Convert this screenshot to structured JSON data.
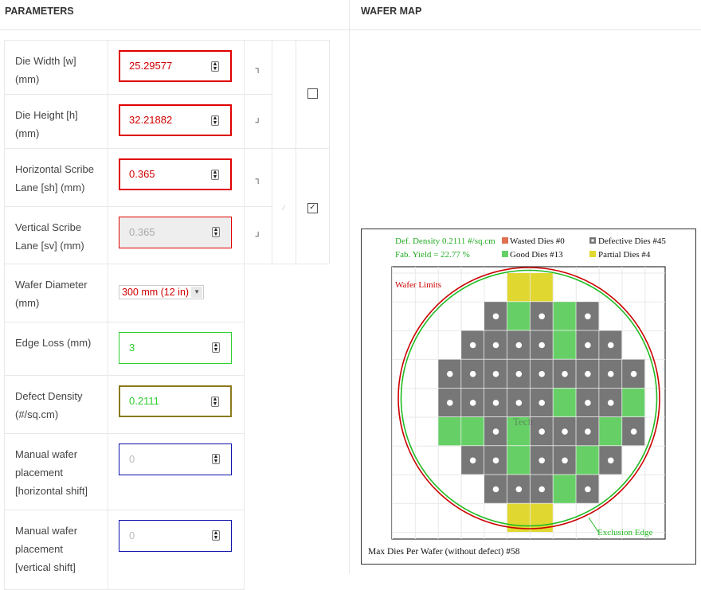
{
  "headers": {
    "parameters": "PARAMETERS",
    "wafer_map": "WAFER MAP"
  },
  "params": [
    {
      "id": "die_width",
      "label": "Die Width [w] (mm)",
      "value": "25.29577"
    },
    {
      "id": "die_height",
      "label": "Die Height [h] (mm)",
      "value": "32.21882"
    },
    {
      "id": "h_scribe",
      "label": "Horizontal Scribe Lane [sh] (mm)",
      "value": "0.365"
    },
    {
      "id": "v_scribe",
      "label": "Vertical Scribe Lane [sv] (mm)",
      "value": "0.365"
    },
    {
      "id": "wafer_diameter",
      "label": "Wafer Diameter (mm)",
      "value": "300 mm (12 in)"
    },
    {
      "id": "edge_loss",
      "label": "Edge Loss (mm)",
      "value": "3"
    },
    {
      "id": "defect_density",
      "label": "Defect Density (#/sq.cm)",
      "value": "0.2111"
    },
    {
      "id": "manual_h",
      "label": "Manual wafer placement [horizontal shift]",
      "placeholder": "0"
    },
    {
      "id": "manual_v",
      "label": "Manual wafer placement [vertical shift]",
      "placeholder": "0"
    }
  ],
  "locks": {
    "size_lock_checked": false,
    "scribe_lock_checked": true
  },
  "wafer_map": {
    "def_density_text": "Def. Density 0.2111 #/sq.cm",
    "fab_yield_text": "Fab. Yield = 22.77 %",
    "legend": [
      {
        "label": "Wasted Dies",
        "count": "#0",
        "color": "#e07050"
      },
      {
        "label": "Defective Dies",
        "count": "#45",
        "color": "#777777"
      },
      {
        "label": "Good Dies",
        "count": "#13",
        "color": "#66d066"
      },
      {
        "label": "Partial Dies",
        "count": "#4",
        "color": "#e0d830"
      }
    ],
    "wafer_limits_label": "Wafer Limits",
    "exclusion_edge_label": "Exclusion Edge",
    "watermark": "Tech",
    "footer": "Max Dies Per Wafer (without defect) #58",
    "colors": {
      "defective": "#777777",
      "good": "#66d066",
      "partial": "#e0d830",
      "wafer_limit": "#cc0000",
      "exclusion": "#22bb22"
    },
    "die_rows": [
      "....PP....",
      "...DGDGD..",
      "..DDDDGDD.",
      ".DDDDDDDDD",
      ".DDDDDGDDG",
      ".GGDGDDDGD",
      "..DDGDDGD.",
      "...DDDGD..",
      "....PP...."
    ]
  }
}
